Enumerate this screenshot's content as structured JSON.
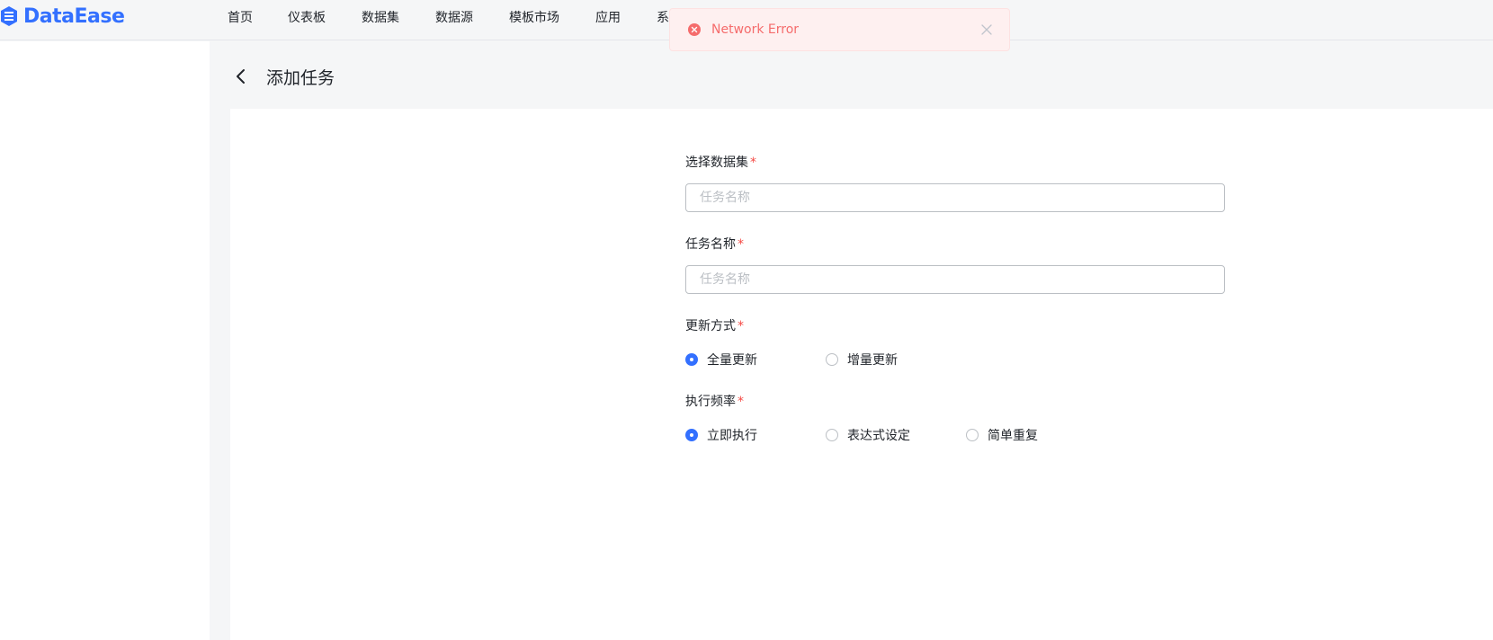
{
  "app": {
    "logo_text": "DataEase"
  },
  "nav": {
    "items": [
      {
        "label": "首页"
      },
      {
        "label": "仪表板"
      },
      {
        "label": "数据集"
      },
      {
        "label": "数据源"
      },
      {
        "label": "模板市场"
      },
      {
        "label": "应用"
      },
      {
        "label": "系"
      }
    ]
  },
  "toast": {
    "message": "Network Error"
  },
  "page": {
    "title": "添加任务"
  },
  "form": {
    "dataset": {
      "label": "选择数据集",
      "required": "*",
      "placeholder": "任务名称",
      "value": ""
    },
    "task_name": {
      "label": "任务名称",
      "required": "*",
      "placeholder": "任务名称",
      "value": ""
    },
    "update_mode": {
      "label": "更新方式",
      "required": "*",
      "options": [
        {
          "label": "全量更新"
        },
        {
          "label": "增量更新"
        }
      ],
      "selected": "全量更新"
    },
    "frequency": {
      "label": "执行频率",
      "required": "*",
      "options": [
        {
          "label": "立即执行"
        },
        {
          "label": "表达式设定"
        },
        {
          "label": "简单重复"
        }
      ],
      "selected": "立即执行"
    }
  },
  "colors": {
    "brand": "#3370ff",
    "error": "#f56c6c",
    "required": "#f54a45"
  }
}
